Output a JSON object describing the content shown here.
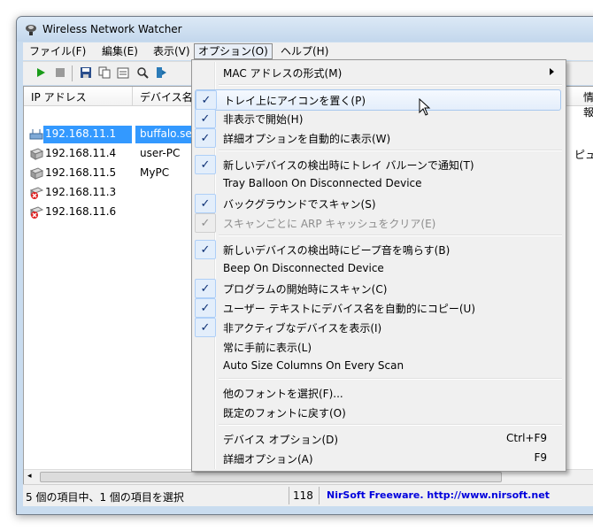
{
  "window": {
    "title": "Wireless Network Watcher"
  },
  "menubar": [
    {
      "label": "ファイル(F)"
    },
    {
      "label": "編集(E)"
    },
    {
      "label": "表示(V)"
    },
    {
      "label": "オプション(O)"
    },
    {
      "label": "ヘルプ(H)"
    }
  ],
  "list": {
    "columns": [
      "IP アドレス",
      "デバイス名",
      "情報"
    ],
    "rows": [
      {
        "ip": "192.168.11.1",
        "name": "buffalo.set",
        "icon": "router-icon"
      },
      {
        "ip": "192.168.11.4",
        "name": "user-PC",
        "icon": "computer-icon"
      },
      {
        "ip": "192.168.11.5",
        "name": "MyPC",
        "icon": "computer-icon"
      },
      {
        "ip": "192.168.11.3",
        "name": "",
        "icon": "inactive-device-icon"
      },
      {
        "ip": "192.168.11.6",
        "name": "",
        "icon": "inactive-device-icon"
      }
    ],
    "row2_extra": "ピュー"
  },
  "status": {
    "selection": "5 個の項目中、1 個の項目を選択",
    "count": "118",
    "credit": "NirSoft Freeware.  http://www.nirsoft.net"
  },
  "options_menu": {
    "items": [
      {
        "label": "MAC アドレスの形式(M)",
        "checked": false,
        "submenu": true
      },
      {
        "label": "トレイ上にアイコンを置く(P)",
        "checked": true
      },
      {
        "label": "非表示で開始(H)",
        "checked": true
      },
      {
        "label": "詳細オプションを自動的に表示(W)",
        "checked": true
      },
      {
        "label": "新しいデバイスの検出時にトレイ バルーンで通知(T)",
        "checked": true
      },
      {
        "label": "Tray Balloon On Disconnected Device",
        "checked": false
      },
      {
        "label": "バックグラウンドでスキャン(S)",
        "checked": true
      },
      {
        "label": "スキャンごとに ARP キャッシュをクリア(E)",
        "checked": true,
        "disabled": true
      },
      {
        "label": "新しいデバイスの検出時にビープ音を鳴らす(B)",
        "checked": true
      },
      {
        "label": "Beep On Disconnected Device",
        "checked": false
      },
      {
        "label": "プログラムの開始時にスキャン(C)",
        "checked": true
      },
      {
        "label": "ユーザー テキストにデバイス名を自動的にコピー(U)",
        "checked": true
      },
      {
        "label": "非アクティブなデバイスを表示(I)",
        "checked": true
      },
      {
        "label": "常に手前に表示(L)",
        "checked": false
      },
      {
        "label": "Auto Size Columns On Every Scan",
        "checked": false
      },
      {
        "label": "他のフォントを選択(F)...",
        "checked": false
      },
      {
        "label": "既定のフォントに戻す(O)",
        "checked": false
      },
      {
        "label": "デバイス オプション(D)",
        "checked": false,
        "shortcut": "Ctrl+F9"
      },
      {
        "label": "詳細オプション(A)",
        "checked": false,
        "shortcut": "F9"
      }
    ],
    "check_glyph": "✓"
  },
  "colors": {
    "selection": "#3399ff",
    "credit": "#0000dd"
  }
}
